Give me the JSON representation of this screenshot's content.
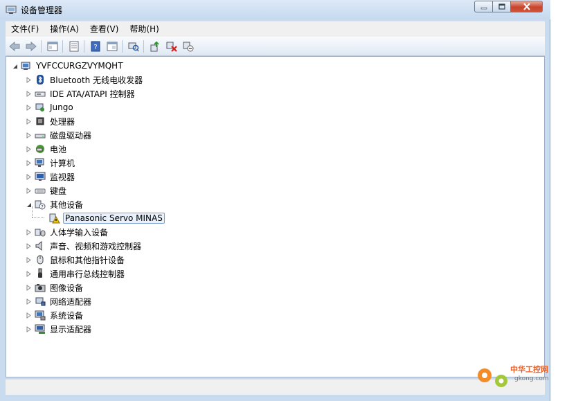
{
  "window": {
    "title": "设备管理器"
  },
  "menu": {
    "items": [
      "文件(F)",
      "操作(A)",
      "查看(V)",
      "帮助(H)"
    ]
  },
  "toolbar": {
    "buttons": [
      "back-icon",
      "forward-icon",
      "show-hide-tree-icon",
      "properties-icon",
      "help-icon",
      "view-icon",
      "scan-hardware-icon",
      "update-driver-icon",
      "uninstall-icon",
      "disable-icon"
    ]
  },
  "tree": {
    "root": "YVFCCURGZVYMQHT",
    "items": [
      {
        "label": "Bluetooth 无线电收发器",
        "icon": "bluetooth-icon"
      },
      {
        "label": "IDE ATA/ATAPI 控制器",
        "icon": "ide-controller-icon"
      },
      {
        "label": "Jungo",
        "icon": "jungo-icon"
      },
      {
        "label": "处理器",
        "icon": "processor-icon"
      },
      {
        "label": "磁盘驱动器",
        "icon": "disk-drive-icon"
      },
      {
        "label": "电池",
        "icon": "battery-icon"
      },
      {
        "label": "计算机",
        "icon": "computer-icon"
      },
      {
        "label": "监视器",
        "icon": "monitor-icon"
      },
      {
        "label": "键盘",
        "icon": "keyboard-icon"
      },
      {
        "label": "其他设备",
        "icon": "other-devices-icon",
        "expanded": true
      },
      {
        "label": "Panasonic Servo MINAS",
        "icon": "warning-device-icon",
        "child": true,
        "selected": true
      },
      {
        "label": "人体学输入设备",
        "icon": "hid-icon"
      },
      {
        "label": "声音、视频和游戏控制器",
        "icon": "sound-icon"
      },
      {
        "label": "鼠标和其他指针设备",
        "icon": "mouse-icon"
      },
      {
        "label": "通用串行总线控制器",
        "icon": "usb-icon"
      },
      {
        "label": "图像设备",
        "icon": "imaging-icon"
      },
      {
        "label": "网络适配器",
        "icon": "network-icon"
      },
      {
        "label": "系统设备",
        "icon": "system-icon"
      },
      {
        "label": "显示适配器",
        "icon": "display-adapter-icon"
      }
    ]
  },
  "watermark": {
    "text": "中华工控网",
    "url": "gkong.com"
  },
  "colors": {
    "accent": "#3c6bb0",
    "warning": "#f2c200",
    "selection_border": "#7da2ce"
  }
}
